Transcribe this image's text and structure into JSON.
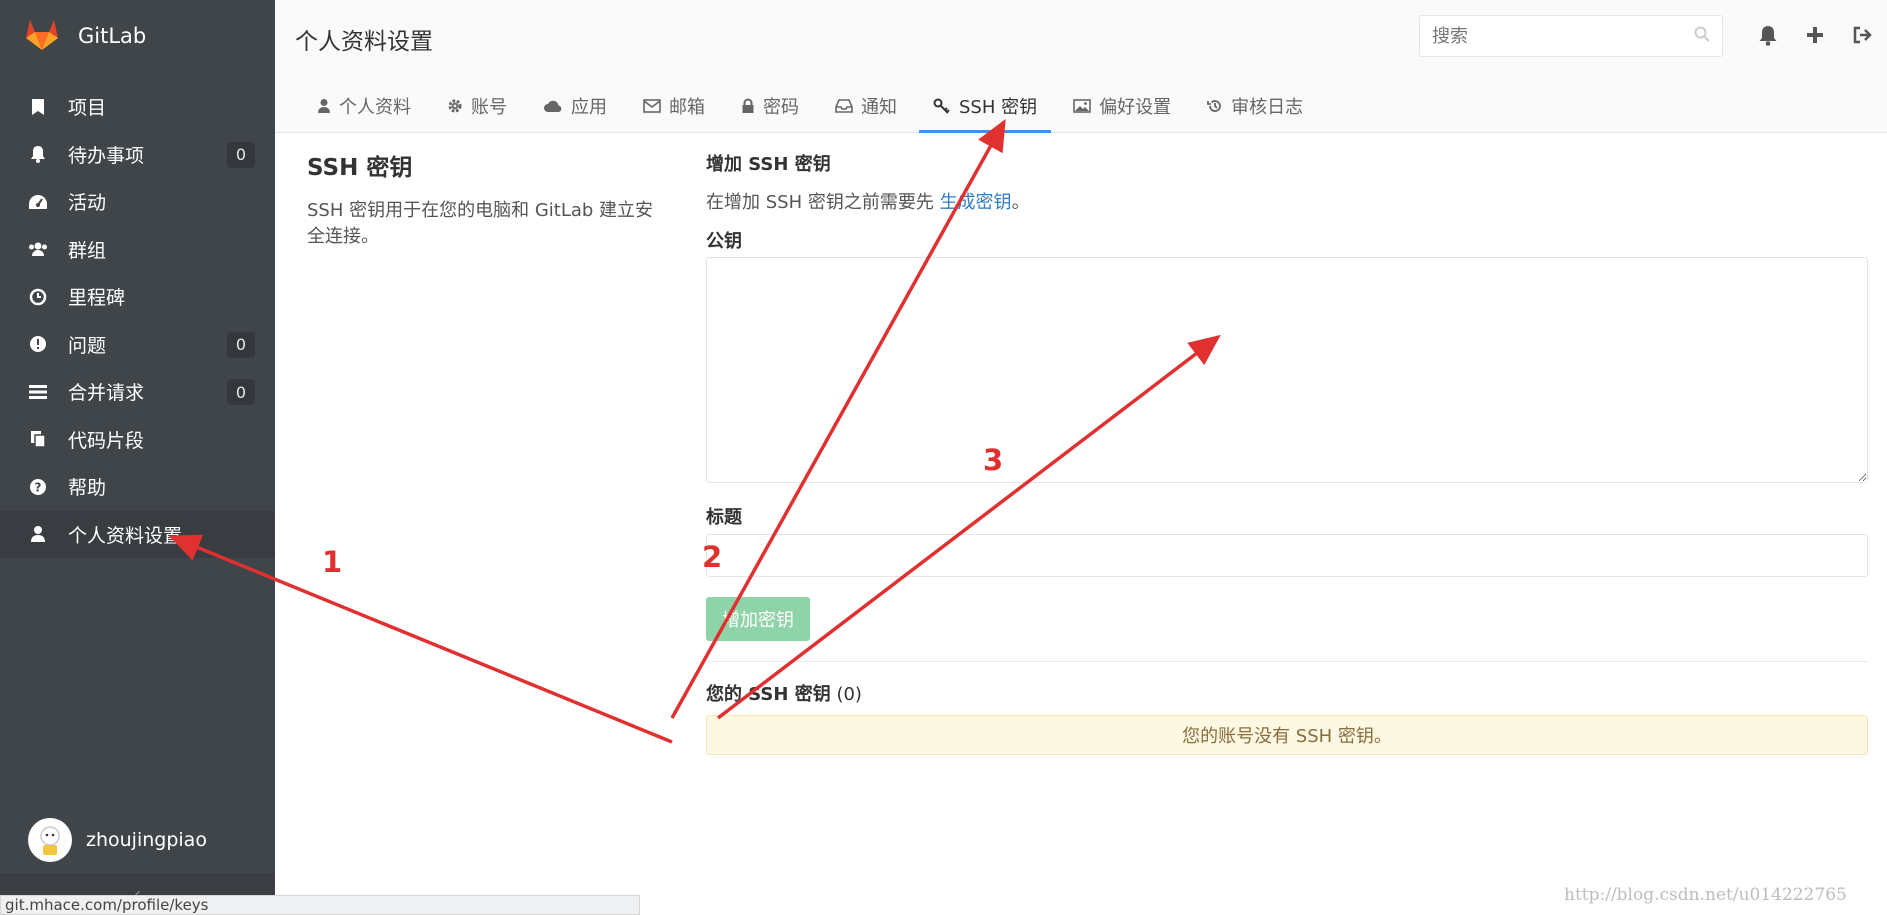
{
  "app": {
    "brand": "GitLab"
  },
  "sidebar": {
    "items": [
      {
        "label": "项目",
        "icon": "bookmark-icon",
        "badge": ""
      },
      {
        "label": "待办事项",
        "icon": "bell-icon",
        "badge": "0"
      },
      {
        "label": "活动",
        "icon": "dashboard-icon",
        "badge": ""
      },
      {
        "label": "群组",
        "icon": "users-icon",
        "badge": ""
      },
      {
        "label": "里程碑",
        "icon": "clock-icon",
        "badge": ""
      },
      {
        "label": "问题",
        "icon": "exclamation-icon",
        "badge": "0"
      },
      {
        "label": "合并请求",
        "icon": "list-icon",
        "badge": "0"
      },
      {
        "label": "代码片段",
        "icon": "copy-icon",
        "badge": ""
      },
      {
        "label": "帮助",
        "icon": "question-icon",
        "badge": ""
      },
      {
        "label": "个人资料设置",
        "icon": "user-icon",
        "badge": "",
        "active": true
      }
    ],
    "user": {
      "name": "zhoujingpiao"
    },
    "collapse_icon": "‹"
  },
  "header": {
    "title": "个人资料设置",
    "search": {
      "placeholder": "搜索"
    },
    "tabs": [
      {
        "label": "个人资料",
        "icon": "user-icon"
      },
      {
        "label": "账号",
        "icon": "gear-icon"
      },
      {
        "label": "应用",
        "icon": "cloud-icon"
      },
      {
        "label": "邮箱",
        "icon": "envelope-icon"
      },
      {
        "label": "密码",
        "icon": "lock-icon"
      },
      {
        "label": "通知",
        "icon": "inbox-icon"
      },
      {
        "label": "SSH 密钥",
        "icon": "key-icon",
        "active": true
      },
      {
        "label": "偏好设置",
        "icon": "image-icon"
      },
      {
        "label": "审核日志",
        "icon": "history-icon"
      }
    ]
  },
  "section": {
    "title": "SSH 密钥",
    "description": "SSH 密钥用于在您的电脑和 GitLab 建立安全连接。"
  },
  "form": {
    "title": "增加 SSH 密钥",
    "hint_prefix": "在增加 SSH 密钥之前需要先 ",
    "hint_link": "生成密钥",
    "hint_suffix": "。",
    "key_label": "公钥",
    "key_value": "",
    "title_label": "标题",
    "title_value": "",
    "submit_label": "增加密钥"
  },
  "keys": {
    "heading_bold": "您的 SSH 密钥",
    "count": "(0)",
    "empty_message": "您的账号没有 SSH 密钥。"
  },
  "status_bar": {
    "url": "git.mhace.com/profile/keys"
  },
  "watermark": "http://blog.csdn.net/u014222765",
  "annotations": {
    "labels": [
      "1",
      "2",
      "3"
    ],
    "color": "#e03030"
  },
  "colors": {
    "sidebar_bg": "#404549",
    "tab_active": "#4a8bee",
    "success_btn": "#8fd3a8",
    "link": "#2e7ec8"
  }
}
